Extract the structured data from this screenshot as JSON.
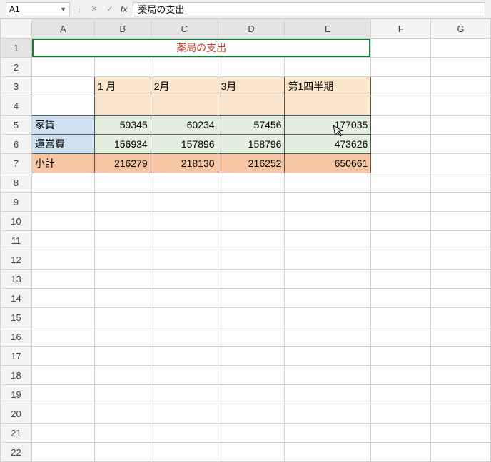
{
  "formulaBar": {
    "nameBox": "A1",
    "fx": "fx",
    "content": "薬局の支出"
  },
  "columns": [
    "A",
    "B",
    "C",
    "D",
    "E",
    "F",
    "G"
  ],
  "rowNumbers": [
    1,
    2,
    3,
    4,
    5,
    6,
    7,
    8,
    9,
    10,
    11,
    12,
    13,
    14,
    15,
    16,
    17,
    18,
    19,
    20,
    21,
    22
  ],
  "title": "薬局の支出",
  "months": {
    "m1": "1 月",
    "m2": "2月",
    "m3": "3月",
    "q1": "第1四半期"
  },
  "rows": {
    "rent": {
      "label": "家賃",
      "m1": "59345",
      "m2": "60234",
      "m3": "57456",
      "q1": "177035"
    },
    "ops": {
      "label": "運営費",
      "m1": "156934",
      "m2": "157896",
      "m3": "158796",
      "q1": "473626"
    },
    "subtotal": {
      "label": "小計",
      "m1": "216279",
      "m2": "218130",
      "m3": "216252",
      "q1": "650661"
    }
  }
}
